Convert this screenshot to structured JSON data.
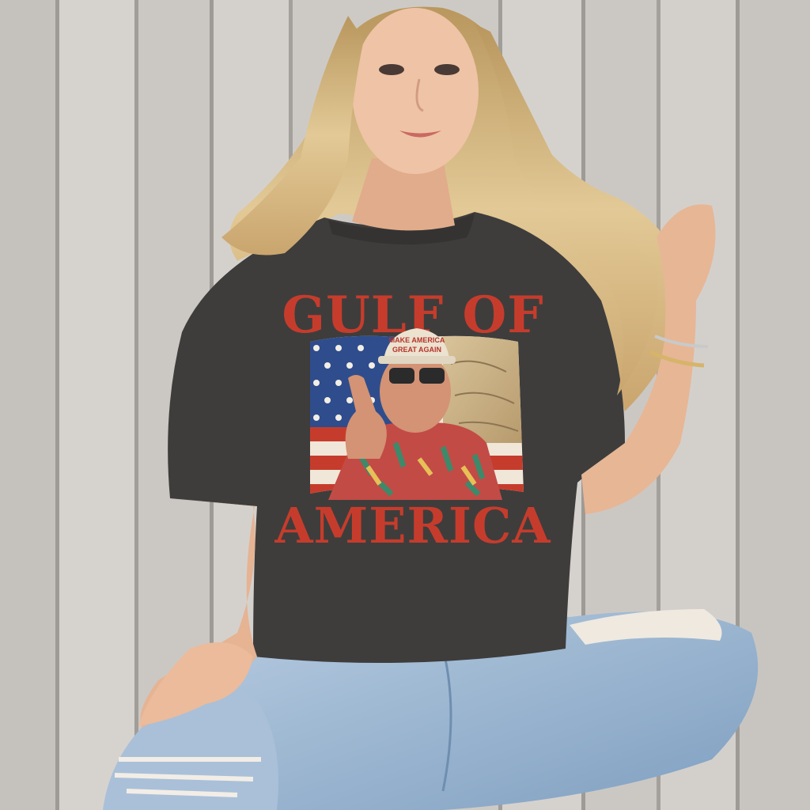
{
  "shirt_print": {
    "line_top": "GULF OF",
    "line_bottom": "AMERICA",
    "cap_line_1": "MAKE AMERICA",
    "cap_line_2": "GREAT AGAIN"
  },
  "colors": {
    "wood_light": "#d3d0cc",
    "wood_dark": "#a9a5a0",
    "shirt": "#3e3d3c",
    "print_red": "#c63c2c",
    "denim": "#9fb8d3",
    "hair": "#d9bf8e",
    "skin": "#e9b99a"
  }
}
